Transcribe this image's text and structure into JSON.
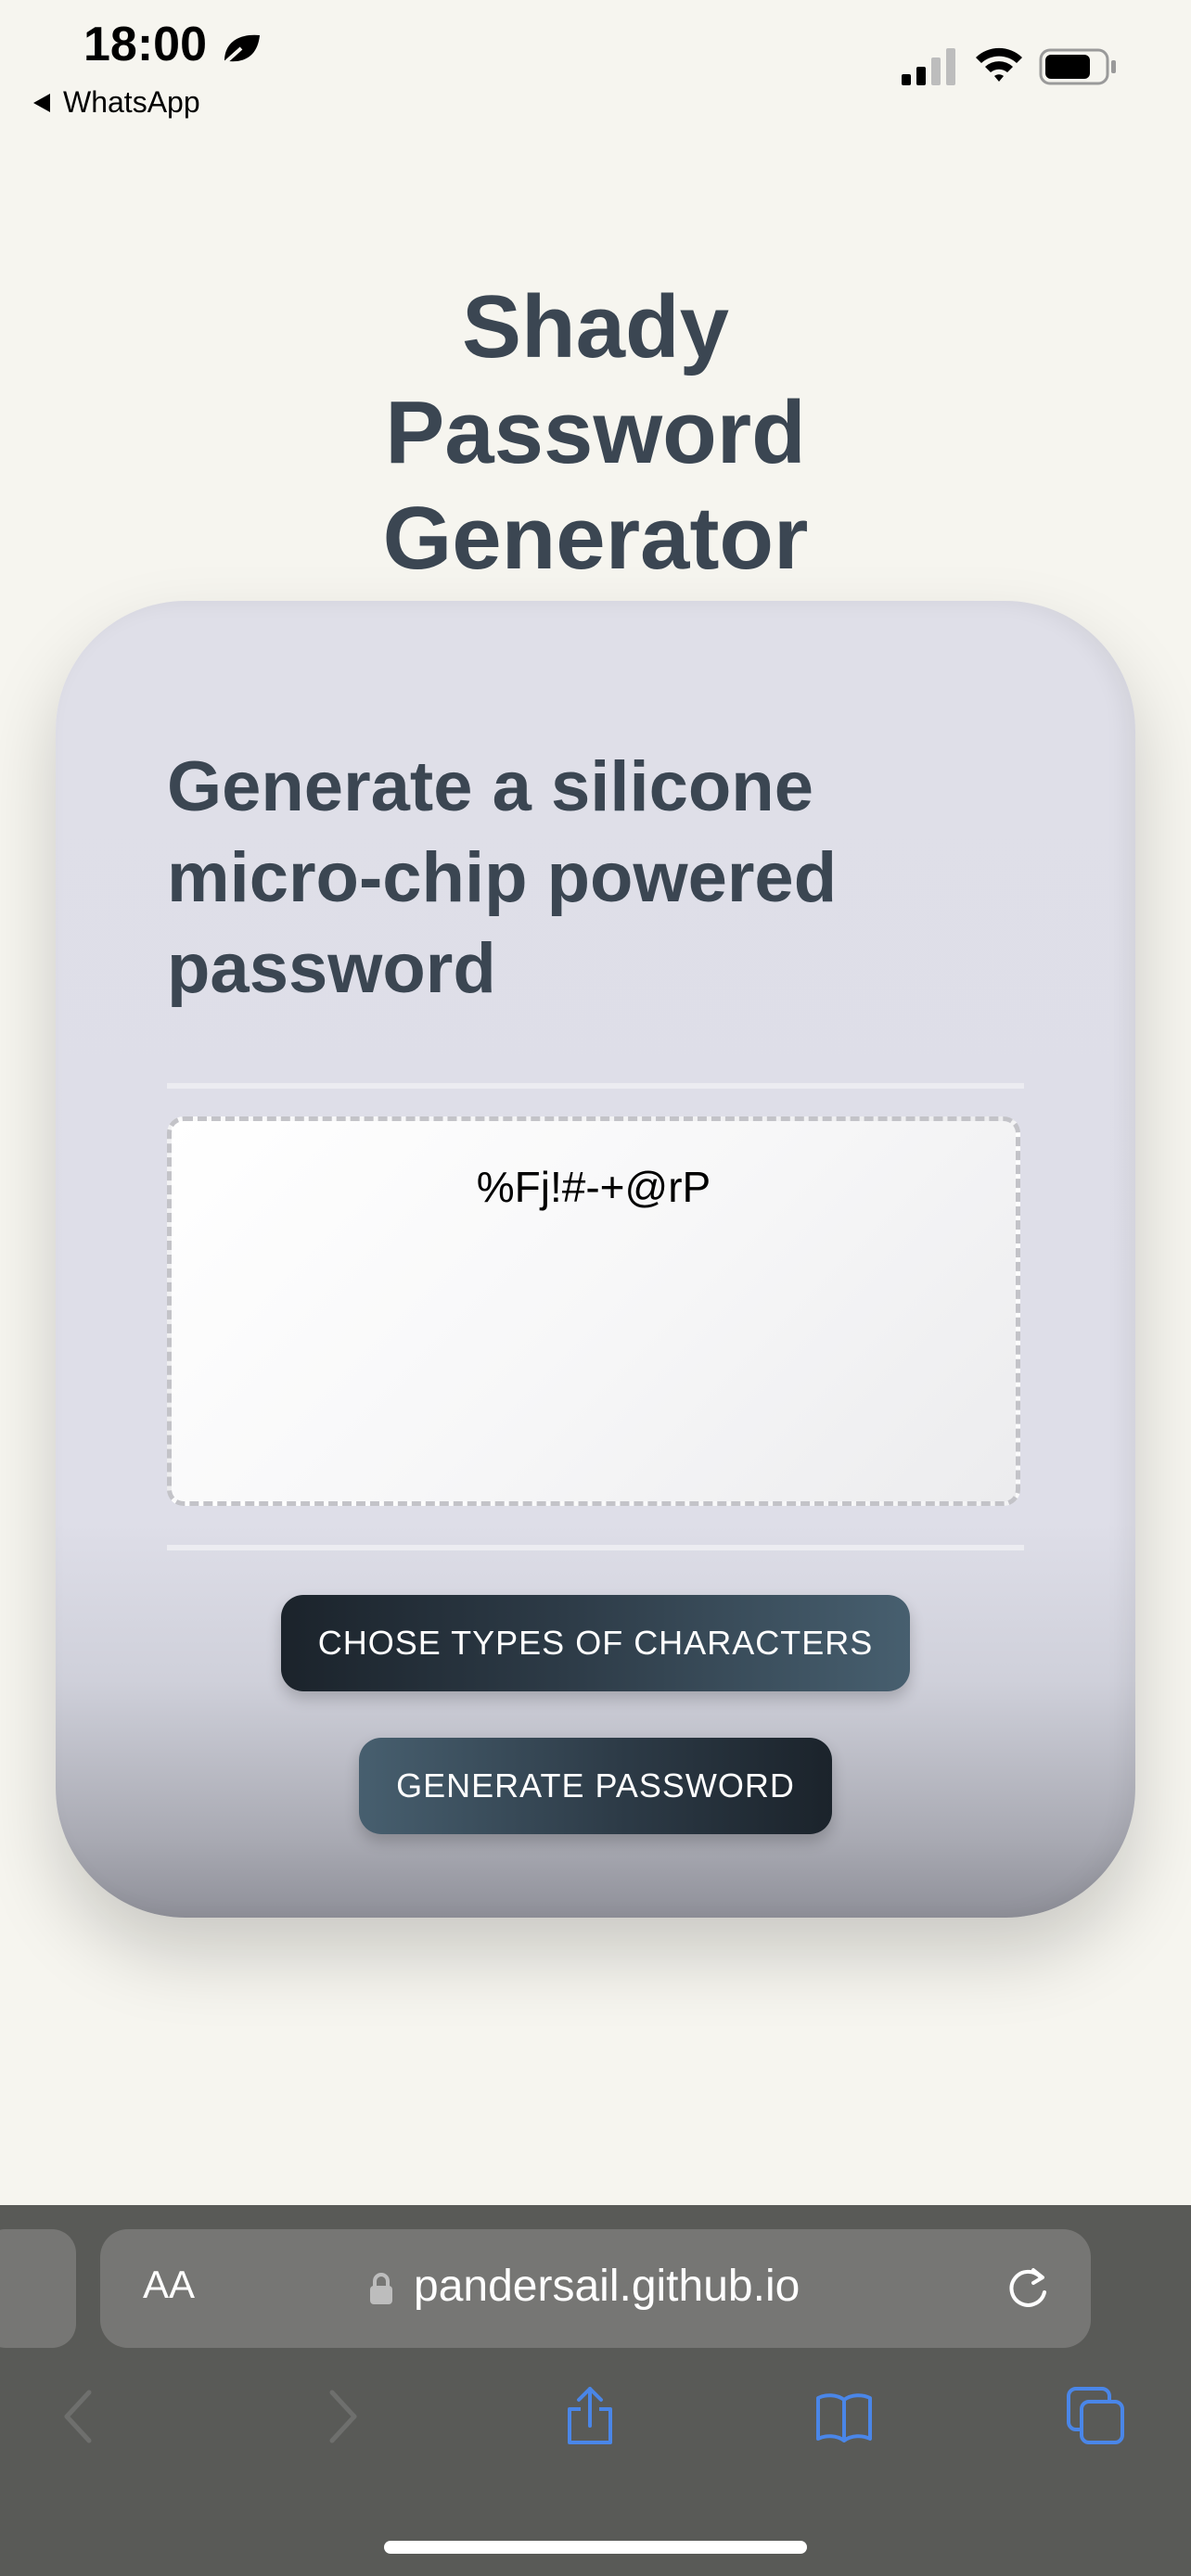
{
  "status_bar": {
    "time": "18:00",
    "back_app": "WhatsApp"
  },
  "page": {
    "title": "Shady Password Generator"
  },
  "card": {
    "heading": "Generate a silicone micro-chip powered password",
    "password": "%Fj!#-+@rP",
    "chose_button": "CHOSE TYPES OF CHARACTERS",
    "generate_button": "GENERATE PASSWORD"
  },
  "browser": {
    "text_size_button": "AA",
    "url": "pandersail.github.io",
    "toolbar_icons": [
      "back-icon",
      "forward-icon",
      "share-icon",
      "bookmarks-icon",
      "tabs-icon"
    ]
  },
  "colors": {
    "background": "#f6f5ef",
    "card": "#dfdfe8",
    "text": "#3b4652",
    "button_dark": "#1b232b",
    "button_light": "#475f6f",
    "browser_bar": "#595a57",
    "link_blue": "#4a86e8"
  }
}
